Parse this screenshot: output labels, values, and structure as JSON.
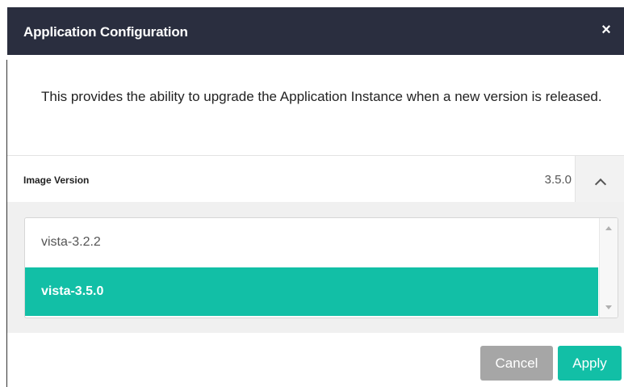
{
  "dialog": {
    "title": "Application Configuration",
    "close_glyph": "×",
    "description": "This provides the ability to upgrade the Application Instance when a new version is released."
  },
  "version_select": {
    "label": "Image Version",
    "current_value": "3.5.0",
    "expanded": true,
    "toggle_icon": "chevron-up-icon",
    "options": [
      {
        "label": "vista-3.2.2",
        "selected": false
      },
      {
        "label": "vista-3.5.0",
        "selected": true
      }
    ]
  },
  "buttons": {
    "cancel_label": "Cancel",
    "apply_label": "Apply"
  },
  "colors": {
    "header_bg": "#2a2e3f",
    "accent": "#12bfa6",
    "cancel_bg": "#a6a6a6",
    "panel_bg": "#f0f0f0"
  }
}
